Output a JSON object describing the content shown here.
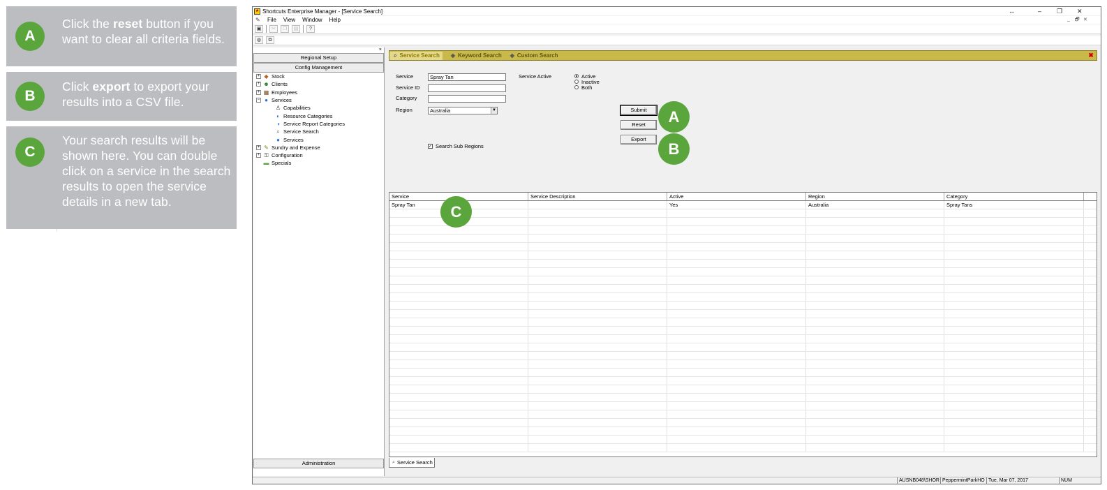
{
  "instructions": [
    {
      "letter": "A",
      "prefix": "Click the ",
      "bold": "reset",
      "suffix": " button if you want to clear all criteria fields."
    },
    {
      "letter": "B",
      "prefix": "Click ",
      "bold": "export",
      "suffix": " to export your results into a CSV file."
    },
    {
      "letter": "C",
      "prefix": "Your search results will be shown here. You can double click on a service in the search results to open the service details in a new tab.",
      "bold": "",
      "suffix": ""
    }
  ],
  "window": {
    "title": "Shortcuts Enterprise Manager - [Service Search]",
    "controls": {
      "restore": "↔",
      "minimize": "–",
      "maximize": "❐",
      "close": "✕"
    },
    "mdi_controls": {
      "minimize": "_",
      "restore": "🗗",
      "close": "✕"
    }
  },
  "menu": [
    "File",
    "View",
    "Window",
    "Help"
  ],
  "nav": {
    "top_buttons": [
      "Regional Setup",
      "Config Management"
    ],
    "bottom_button": "Administration",
    "close_glyph": "×",
    "tree": [
      {
        "label": "Stock",
        "expander": "+",
        "icon": "stock-icon",
        "level": 0
      },
      {
        "label": "Clients",
        "expander": "+",
        "icon": "clients-icon",
        "level": 0
      },
      {
        "label": "Employees",
        "expander": "+",
        "icon": "employees-icon",
        "level": 0
      },
      {
        "label": "Services",
        "expander": "−",
        "icon": "services-icon",
        "level": 0
      },
      {
        "label": "Capabilities",
        "expander": "",
        "icon": "capabilities-icon",
        "level": 1
      },
      {
        "label": "Resource Categories",
        "expander": "",
        "icon": "resource-categories-icon",
        "level": 1
      },
      {
        "label": "Service Report Categories",
        "expander": "",
        "icon": "service-report-categories-icon",
        "level": 1
      },
      {
        "label": "Service Search",
        "expander": "",
        "icon": "service-search-icon",
        "level": 1
      },
      {
        "label": "Services",
        "expander": "",
        "icon": "services-leaf-icon",
        "level": 1
      },
      {
        "label": "Sundry and Expense",
        "expander": "+",
        "icon": "sundry-icon",
        "level": 0
      },
      {
        "label": "Configuration",
        "expander": "+",
        "icon": "configuration-icon",
        "level": 0
      },
      {
        "label": "Specials",
        "expander": "",
        "icon": "specials-icon",
        "level": 0
      }
    ]
  },
  "search_tabs": [
    "Service Search",
    "Keyword Search",
    "Custom Search"
  ],
  "form": {
    "service_label": "Service",
    "service_value": "Spray Tan",
    "service_id_label": "Service ID",
    "service_id_value": "",
    "category_label": "Category",
    "category_value": "",
    "region_label": "Region",
    "region_value": "Australia",
    "active_label": "Service Active",
    "active_options": [
      "Active",
      "Inactive",
      "Both"
    ],
    "active_selected": "Active",
    "sub_regions_label": "Search Sub Regions",
    "sub_regions_checked": true,
    "submit_label": "Submit",
    "reset_label": "Reset",
    "export_label": "Export"
  },
  "results": {
    "columns": [
      "Service",
      "Service  Description",
      "Active",
      "Region",
      "Category"
    ],
    "rows": [
      [
        "Spray Tan",
        "",
        "Yes",
        "Australia",
        "Spray Tans"
      ]
    ]
  },
  "bottom_tab": "Service Search",
  "status": {
    "user": "AUSNB048\\SHOR",
    "location": "PeppermintParkHO",
    "date": "Tue, Mar 07, 2017",
    "mode": "NUM"
  },
  "overlay_badges": [
    "A",
    "B",
    "C"
  ],
  "colors": {
    "badge_green": "#5aa63c",
    "panel_grey": "#bcbdc0",
    "tab_gold": "#c9b94a"
  }
}
